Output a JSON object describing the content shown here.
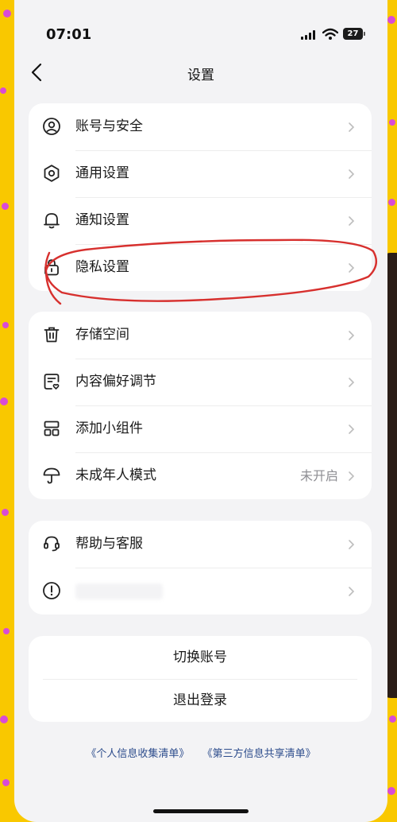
{
  "status_bar": {
    "time": "07:01",
    "battery": "27"
  },
  "nav": {
    "title": "设置"
  },
  "groups": [
    {
      "items": [
        {
          "icon": "user-circle-icon",
          "label": "账号与安全"
        },
        {
          "icon": "gear-icon",
          "label": "通用设置"
        },
        {
          "icon": "bell-icon",
          "label": "通知设置"
        },
        {
          "icon": "lock-icon",
          "label": "隐私设置"
        }
      ]
    },
    {
      "items": [
        {
          "icon": "trash-icon",
          "label": "存储空间"
        },
        {
          "icon": "content-preference-icon",
          "label": "内容偏好调节"
        },
        {
          "icon": "widget-grid-icon",
          "label": "添加小组件"
        },
        {
          "icon": "umbrella-icon",
          "label": "未成年人模式",
          "value": "未开启"
        }
      ]
    },
    {
      "items": [
        {
          "icon": "headset-icon",
          "label": "帮助与客服"
        },
        {
          "icon": "info-circle-icon",
          "label": ""
        }
      ]
    }
  ],
  "account_actions": {
    "switch_account": "切换账号",
    "logout": "退出登录"
  },
  "footer_links": {
    "personal_info": "《个人信息收集清单》",
    "third_party": "《第三方信息共享清单》"
  },
  "colors": {
    "background": "#F9C800",
    "accent_dots": "#D94BD6",
    "annotation_red": "#D7302E",
    "link": "#2C4C8C"
  }
}
